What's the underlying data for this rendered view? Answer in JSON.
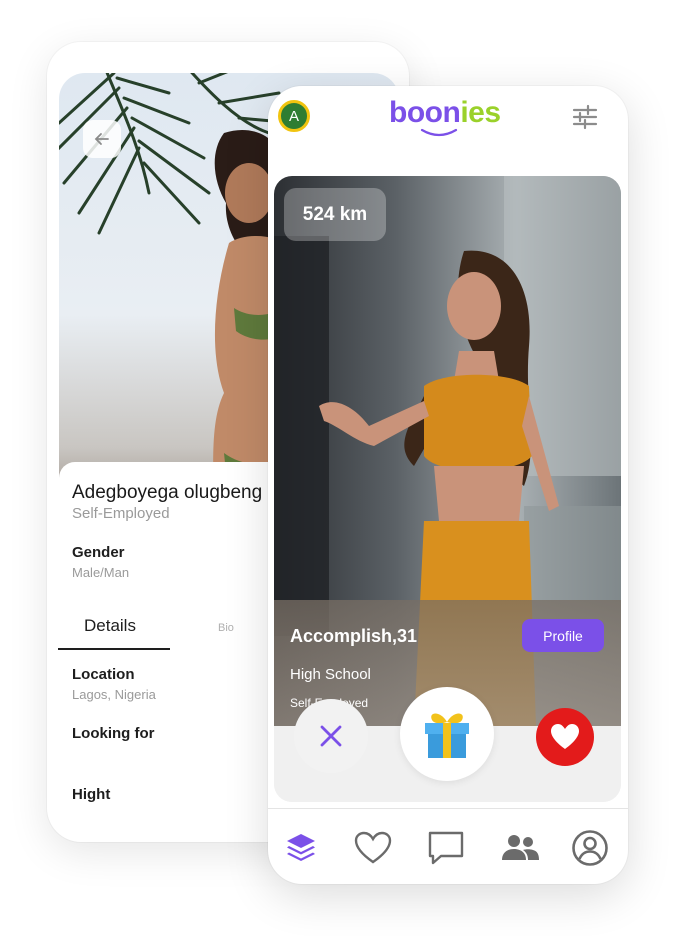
{
  "back_screen": {
    "name": "Adegboyega olugbeng",
    "occupation": "Self-Employed",
    "gender_label": "Gender",
    "gender_value": "Male/Man",
    "tabs": [
      "Details",
      "Bio"
    ],
    "location_label": "Location",
    "location_value": "Lagos, Nigeria",
    "looking_for_label": "Looking for",
    "height_label": "Hight",
    "icons": {
      "back": "arrow-left-icon"
    }
  },
  "front_screen": {
    "avatar_initial": "A",
    "logo_part1": "boon",
    "logo_part2": "ies",
    "distance": "524 km",
    "profile": {
      "name_age": "Accomplish,31",
      "education": "High School",
      "occupation": "Self-Employed",
      "profile_button": "Profile"
    },
    "actions": [
      "dislike-icon",
      "gift-icon",
      "like-icon"
    ],
    "nav": [
      "stack-icon",
      "heart-outline-icon",
      "chat-icon",
      "people-icon",
      "account-icon"
    ],
    "colors": {
      "accent": "#7b50e8",
      "logo_green": "#9ad12a",
      "like": "#e31b1b",
      "nav_active": "#7b50e8",
      "nav_inactive": "#6b6b6b"
    }
  }
}
